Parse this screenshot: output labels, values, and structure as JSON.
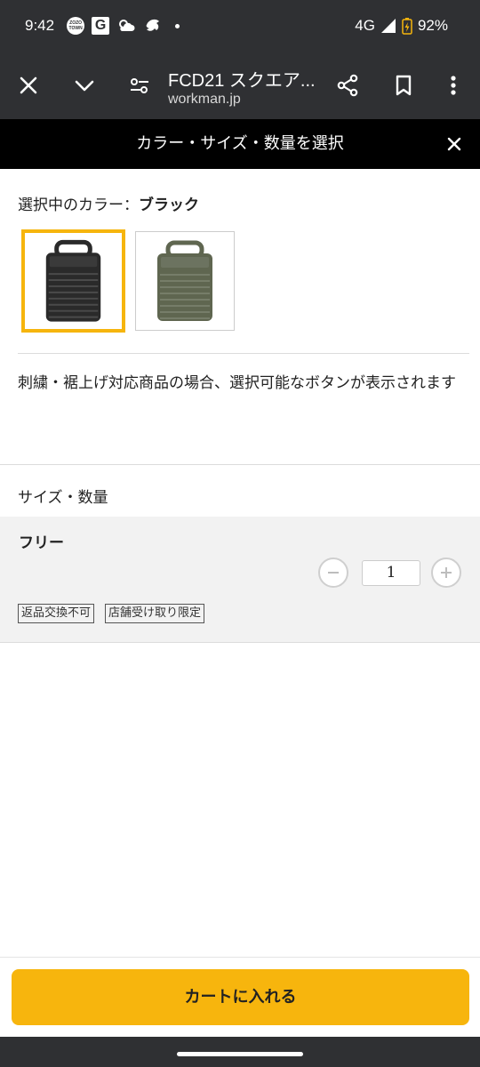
{
  "status_bar": {
    "time": "9:42",
    "zozo_badge": "ZOZO TOWN",
    "g_badge": "G",
    "network": "4G",
    "battery": "92%"
  },
  "browser": {
    "title": "FCD21 スクエア...",
    "url": "workman.jp"
  },
  "modal": {
    "title": "カラー・サイズ・数量を選択"
  },
  "color": {
    "label_prefix": "選択中のカラー：",
    "selected_name": "ブラック",
    "options": [
      {
        "name": "ブラック",
        "fill": "#2a2a2a",
        "selected": true
      },
      {
        "name": "カーキ",
        "fill": "#5f6650",
        "selected": false
      }
    ]
  },
  "notice": "刺繍・裾上げ対応商品の場合、選択可能なボタンが表示されます",
  "size_section": {
    "label": "サイズ・数量",
    "item": {
      "size": "フリー",
      "quantity": "1",
      "tags": [
        "返品交換不可",
        "店舗受け取り限定"
      ]
    }
  },
  "cart": {
    "button_label": "カートに入れる"
  },
  "colors": {
    "accent": "#f7b50d",
    "status_bar": "#2f3033",
    "modal_header": "#000000",
    "panel_bg": "#f2f2f2"
  }
}
